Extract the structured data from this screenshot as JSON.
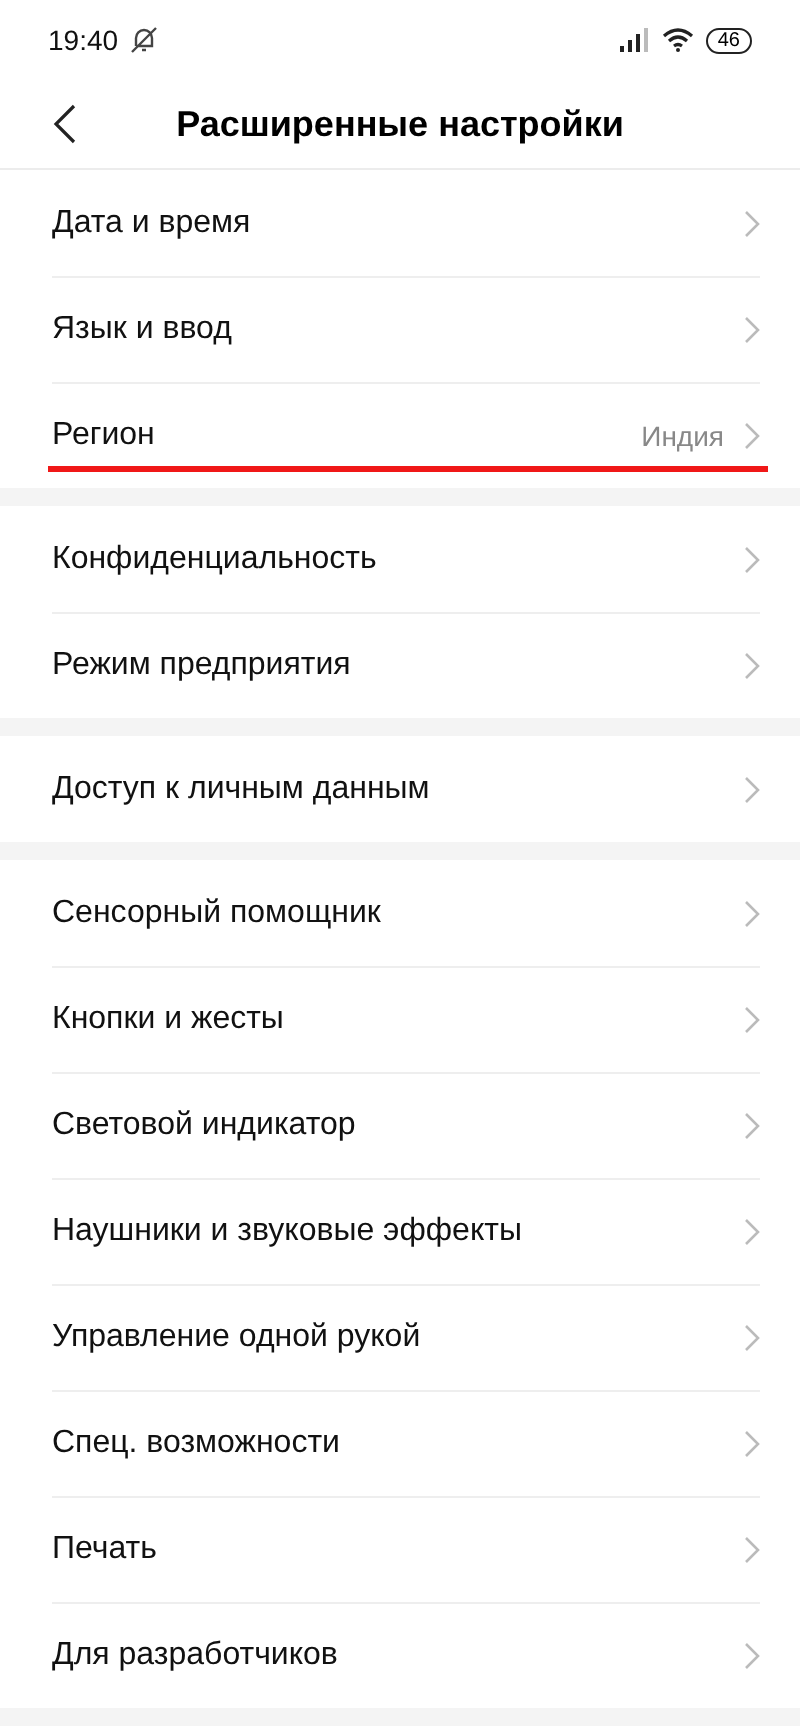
{
  "status_bar": {
    "time": "19:40",
    "battery": "46"
  },
  "header": {
    "title": "Расширенные настройки"
  },
  "groups": [
    {
      "items": [
        {
          "label": "Дата и время",
          "highlighted": false
        },
        {
          "label": "Язык и ввод",
          "highlighted": false
        },
        {
          "label": "Регион",
          "value": "Индия",
          "highlighted": true
        }
      ]
    },
    {
      "items": [
        {
          "label": "Конфиденциальность",
          "highlighted": false
        },
        {
          "label": "Режим предприятия",
          "highlighted": false
        }
      ]
    },
    {
      "items": [
        {
          "label": "Доступ к личным данным",
          "highlighted": false
        }
      ]
    },
    {
      "items": [
        {
          "label": "Сенсорный помощник",
          "highlighted": false
        },
        {
          "label": "Кнопки и жесты",
          "highlighted": false
        },
        {
          "label": "Световой индикатор",
          "highlighted": false
        },
        {
          "label": "Наушники и звуковые эффекты",
          "highlighted": false
        },
        {
          "label": "Управление одной рукой",
          "highlighted": false
        },
        {
          "label": "Спец. возможности",
          "highlighted": false
        },
        {
          "label": "Печать",
          "highlighted": false
        },
        {
          "label": "Для разработчиков",
          "highlighted": false
        }
      ]
    }
  ]
}
